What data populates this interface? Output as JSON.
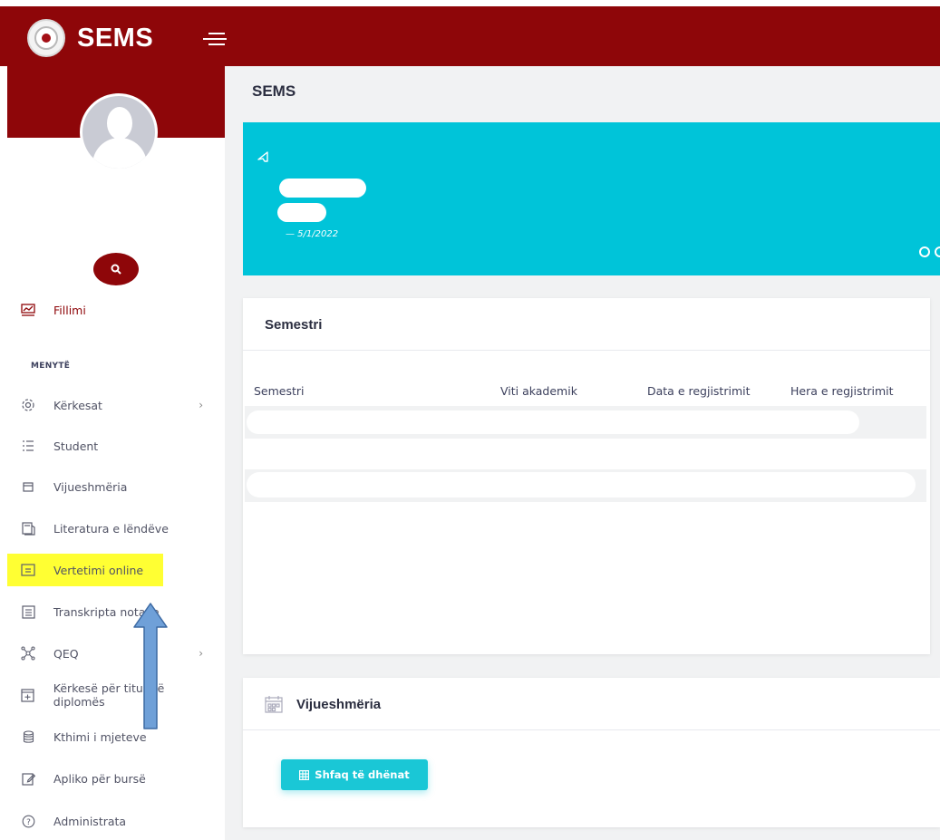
{
  "app": {
    "title": "SEMS"
  },
  "page": {
    "title": "SEMS"
  },
  "announcement": {
    "date": "— 5/1/2022"
  },
  "sidebar": {
    "section_label": "MENYTË",
    "items": [
      {
        "label": "Fillimi",
        "icon": "chart-line-icon"
      },
      {
        "label": "Kërkesat",
        "icon": "settings-icon",
        "expandable": true
      },
      {
        "label": "Student",
        "icon": "list-icon"
      },
      {
        "label": "Vijueshmëria",
        "icon": "calendar-icon"
      },
      {
        "label": "Literatura e lëndëve",
        "icon": "book-icon"
      },
      {
        "label": "Vertetimi online",
        "icon": "folder-icon",
        "highlighted": true
      },
      {
        "label": "Transkripta notave",
        "icon": "transcript-icon"
      },
      {
        "label": "QEQ",
        "icon": "network-icon",
        "expandable": true
      },
      {
        "label": "Kërkesë për titull të diplomës",
        "icon": "plus-square-icon"
      },
      {
        "label": "Kthimi i mjeteve",
        "icon": "coins-icon"
      },
      {
        "label": "Apliko për bursë",
        "icon": "edit-icon"
      },
      {
        "label": "Administrata",
        "icon": "help-circle-icon"
      }
    ]
  },
  "semester_card": {
    "title": "Semestri",
    "columns": [
      "Semestri",
      "Viti akademik",
      "Data e regjistrimit",
      "Hera e regjistrimit"
    ]
  },
  "attendance_card": {
    "title": "Vijueshmëria",
    "button_label": "Shfaq të dhënat"
  },
  "colors": {
    "brand": "#8e0609",
    "banner": "#00c4d9",
    "button": "#1ac7d6",
    "highlight": "#ffff33",
    "arrow": "#6fa0d8"
  }
}
